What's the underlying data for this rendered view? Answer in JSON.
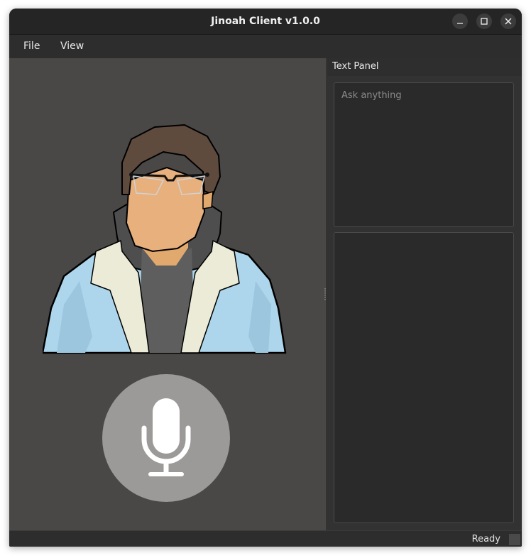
{
  "window": {
    "title": "Jinoah Client v1.0.0",
    "controls": [
      "minimize-icon",
      "maximize-icon",
      "close-icon"
    ]
  },
  "menu": {
    "items": [
      {
        "label": "File"
      },
      {
        "label": "View"
      }
    ]
  },
  "avatar": {
    "icon": "person-avatar-illustration"
  },
  "mic": {
    "icon": "microphone-icon"
  },
  "text_panel": {
    "title": "Text Panel",
    "input_placeholder": "Ask anything",
    "input_value": "",
    "output_text": ""
  },
  "status": {
    "text": "Ready"
  },
  "colors": {
    "background": "#4a4847",
    "panel": "#2a2a2a",
    "mic_button": "#9c9a98"
  }
}
